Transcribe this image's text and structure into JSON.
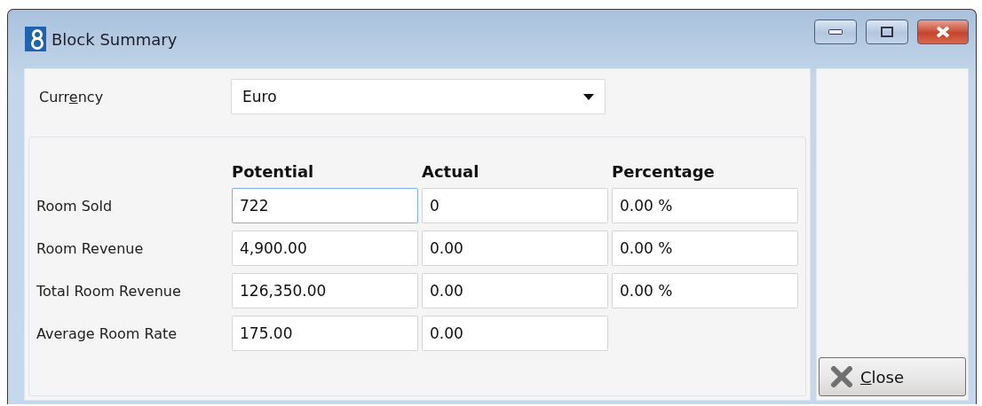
{
  "window": {
    "title": "Block Summary"
  },
  "currency": {
    "label": "Currency",
    "value": "Euro"
  },
  "columns": [
    "Potential",
    "Actual",
    "Percentage"
  ],
  "rows": [
    {
      "label": "Room Sold",
      "cells": [
        {
          "value": "722",
          "focused": true
        },
        {
          "value": "0",
          "focused": false
        },
        {
          "value": "0.00 %",
          "focused": false
        }
      ]
    },
    {
      "label": "Room Revenue",
      "cells": [
        {
          "value": "4,900.00",
          "focused": false
        },
        {
          "value": "0.00",
          "focused": false
        },
        {
          "value": "0.00 %",
          "focused": false
        }
      ]
    },
    {
      "label": "Total Room Revenue",
      "cells": [
        {
          "value": "126,350.00",
          "focused": false
        },
        {
          "value": "0.00",
          "focused": false
        },
        {
          "value": "0.00 %",
          "focused": false
        }
      ]
    },
    {
      "label": "Average Room Rate",
      "cells": [
        {
          "value": "175.00",
          "focused": false
        },
        {
          "value": "0.00",
          "focused": false
        }
      ]
    }
  ],
  "close_button": {
    "label": "Close"
  }
}
